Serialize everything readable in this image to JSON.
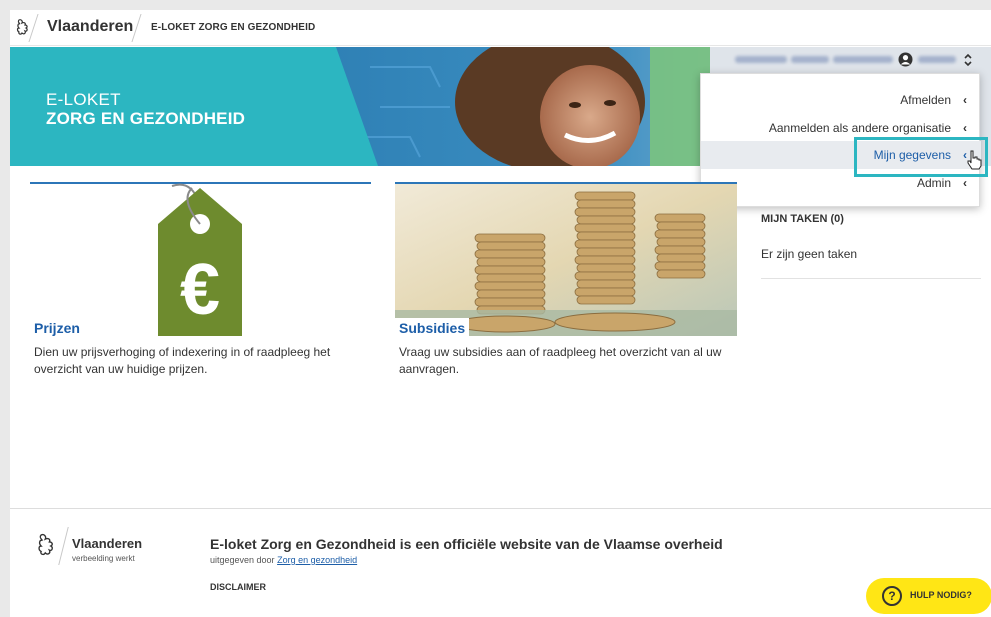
{
  "header": {
    "brand": "Vlaanderen",
    "app_name": "E-LOKET ZORG EN GEZONDHEID"
  },
  "hero": {
    "line1": "E-LOKET",
    "line2": "ZORG EN GEZONDHEID"
  },
  "user_menu": {
    "items": [
      {
        "label": "Afmelden"
      },
      {
        "label": "Aanmelden als andere organisatie"
      },
      {
        "label": "Mijn gegevens"
      },
      {
        "label": "Admin"
      }
    ]
  },
  "cards": [
    {
      "title": "Prijzen",
      "description": "Dien uw prijsverhoging of indexering in of raadpleeg het overzicht van uw huidige prijzen."
    },
    {
      "title": "Subsidies",
      "description": "Vraag uw subsidies aan of raadpleeg het overzicht van al uw aanvragen."
    }
  ],
  "tasks": {
    "title": "MIJN TAKEN (0)",
    "empty": "Er zijn geen taken"
  },
  "footer": {
    "brand": "Vlaanderen",
    "tagline": "verbeelding werkt",
    "title": "E-loket Zorg en Gezondheid is een officiële website van de Vlaamse overheid",
    "published_prefix": "uitgegeven door",
    "published_link": "Zorg en gezondheid",
    "disclaimer": "DISCLAIMER"
  },
  "help": {
    "label": "HULP NODIG?",
    "icon_glyph": "?"
  },
  "colors": {
    "teal": "#2cb6c1",
    "link_blue": "#1d5ea8",
    "help_yellow": "#ffe615",
    "tag_green": "#6e8b2e"
  }
}
